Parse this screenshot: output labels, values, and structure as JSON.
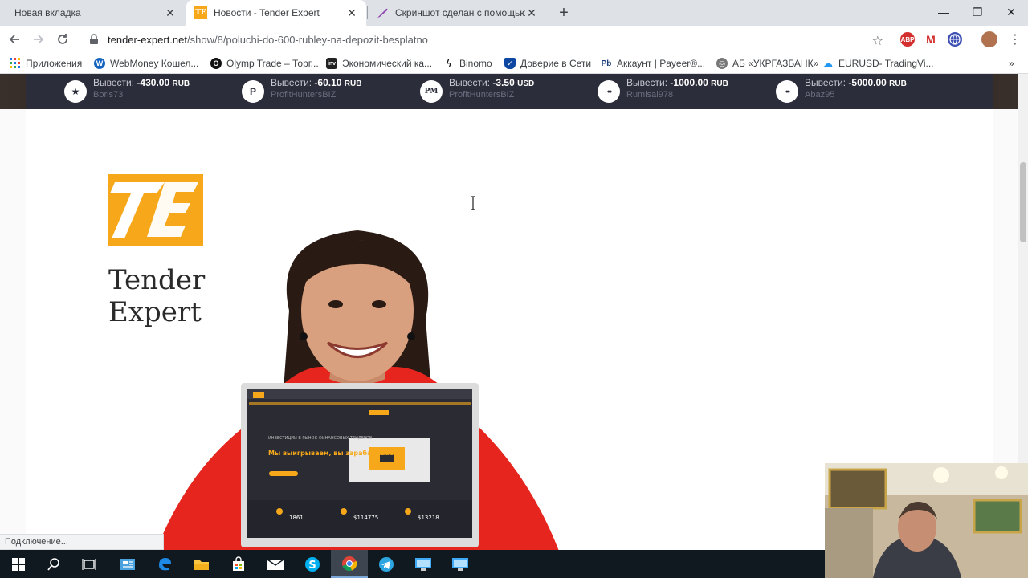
{
  "tabs": [
    {
      "title": "Новая вкладка",
      "active": false
    },
    {
      "title": "Новости - Tender Expert",
      "active": true
    },
    {
      "title": "Скриншот сделан с помощью L",
      "active": false
    }
  ],
  "tab_close_glyph": "✕",
  "new_tab_glyph": "+",
  "window_controls": {
    "minimize": "—",
    "restore": "❐",
    "close": "✕"
  },
  "address": {
    "host": "tender-expert.net",
    "path": "/show/8/poluchi-do-600-rubley-na-depozit-besplatno"
  },
  "extensions": [
    {
      "name": "abp-icon",
      "label": "ABP",
      "color": "#d32f2f"
    },
    {
      "name": "gmail-icon",
      "label": "M",
      "color": "#ffffff"
    },
    {
      "name": "globe-icon",
      "label": "",
      "color": "#3f51b5"
    },
    {
      "name": "profile-avatar",
      "label": "",
      "color": "#b0724f"
    }
  ],
  "bookmarks": [
    {
      "label": "Приложения",
      "icon": "apps-grid-icon"
    },
    {
      "label": "WebMoney Кошел...",
      "icon": "webmoney-icon"
    },
    {
      "label": "Olymp Trade – Торг...",
      "icon": "olymp-icon"
    },
    {
      "label": "Экономический ка...",
      "icon": "investing-icon",
      "badge": "inv"
    },
    {
      "label": "Binomo",
      "icon": "binomo-icon"
    },
    {
      "label": "Доверие в Сети",
      "icon": "trust-shield-icon"
    },
    {
      "label": "Аккаунт | Payeer®...",
      "icon": "payeer-icon",
      "badge": "Pb"
    },
    {
      "label": "АБ «УКРГАЗБАНК»",
      "icon": "bank-globe-icon"
    },
    {
      "label": "EURUSD- TradingVi...",
      "icon": "tradingview-cloud-icon"
    }
  ],
  "bookmarks_overflow": "»",
  "ticker": [
    {
      "action": "Вывести:",
      "amount": "-430.00",
      "currency": "RUB",
      "user": "Boris73",
      "icon": "advcash-star-icon",
      "glyph": "★"
    },
    {
      "action": "Вывести:",
      "amount": "-60.10",
      "currency": "RUB",
      "user": "ProfitHuntersBIZ",
      "icon": "payeer-p-icon",
      "glyph": "P"
    },
    {
      "action": "Вывести:",
      "amount": "-3.50",
      "currency": "USD",
      "user": "ProfitHuntersBIZ",
      "icon": "perfect-money-icon",
      "glyph": "PM"
    },
    {
      "action": "Вывести:",
      "amount": "-1000.00",
      "currency": "RUB",
      "user": "Rumisal978",
      "icon": "mastercard-icon",
      "glyph": "●●"
    },
    {
      "action": "Вывести:",
      "amount": "-5000.00",
      "currency": "RUB",
      "user": "Abaz95",
      "icon": "mastercard-icon",
      "glyph": "●●"
    }
  ],
  "hero": {
    "brand_line1": "Tender",
    "brand_line2": "Expert",
    "laptop_slogan_small": "ИНВЕСТИЦИИ В РЫНОК ФИНАНСОВЫХ ТЕНДЕРОВ",
    "laptop_slogan_main": "Мы выигрываем, вы зарабатываете!",
    "laptop_stats": [
      "1861",
      "$114775",
      "$13218"
    ]
  },
  "status_text": "Подключение...",
  "colors": {
    "brand": "#f6a81a",
    "ticker_bg": "#2c2d3a",
    "tabstrip": "#dee1e6"
  }
}
